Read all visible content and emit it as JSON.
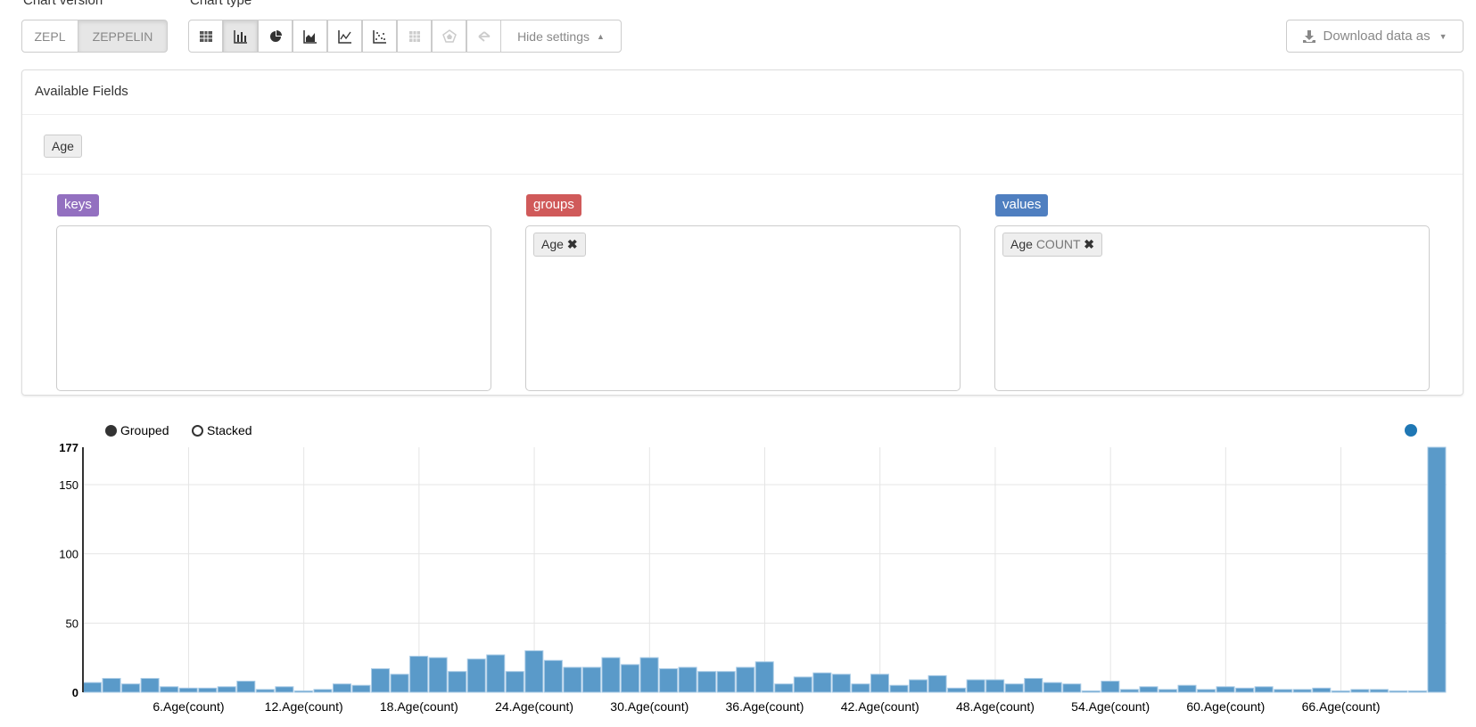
{
  "chart_version": {
    "label": "Chart version",
    "options": [
      "ZEPL",
      "ZEPPELIN"
    ],
    "active": "ZEPPELIN"
  },
  "chart_type": {
    "label": "Chart type",
    "icons": [
      "table-icon",
      "bar-chart-icon",
      "pie-chart-icon",
      "area-chart-icon",
      "line-chart-icon",
      "scatter-chart-icon",
      "heatmap-icon",
      "radar-icon",
      "network-icon"
    ],
    "active": "bar-chart-icon",
    "hide_settings": "Hide settings"
  },
  "download": {
    "label": "Download data as"
  },
  "settings": {
    "available_fields_title": "Available Fields",
    "fields": [
      "Age"
    ],
    "keys": {
      "label": "keys",
      "color": "#9370c0",
      "items": []
    },
    "groups": {
      "label": "groups",
      "color": "#d9534f",
      "items": [
        {
          "name": "Age",
          "agg": ""
        }
      ]
    },
    "values": {
      "label": "values",
      "color": "#4f7fc0",
      "items": [
        {
          "name": "Age",
          "agg": "COUNT"
        }
      ]
    }
  },
  "legend": {
    "grouped": "Grouped",
    "stacked": "Stacked",
    "mode": "Grouped"
  },
  "chart_data": {
    "type": "bar",
    "color": "#5a9ac9",
    "ylim": [
      0,
      177
    ],
    "yticks": [
      0,
      50,
      100,
      150,
      177
    ],
    "grid": true,
    "xtick_labels": [
      "6.Age(count)",
      "12.Age(count)",
      "18.Age(count)",
      "24.Age(count)",
      "30.Age(count)",
      "36.Age(count)",
      "42.Age(count)",
      "48.Age(count)",
      "54.Age(count)",
      "60.Age(count)",
      "66.Age(count)"
    ],
    "values": [
      7,
      10,
      6,
      10,
      4,
      3,
      3,
      4,
      8,
      2,
      4,
      1,
      2,
      6,
      5,
      17,
      13,
      26,
      25,
      15,
      24,
      27,
      15,
      30,
      23,
      18,
      18,
      25,
      20,
      25,
      17,
      18,
      15,
      15,
      18,
      22,
      6,
      11,
      14,
      13,
      6,
      13,
      5,
      9,
      12,
      3,
      9,
      9,
      6,
      10,
      7,
      6,
      1,
      8,
      2,
      4,
      2,
      5,
      2,
      4,
      3,
      4,
      2,
      2,
      3,
      1,
      2,
      2,
      1,
      1,
      177
    ]
  }
}
